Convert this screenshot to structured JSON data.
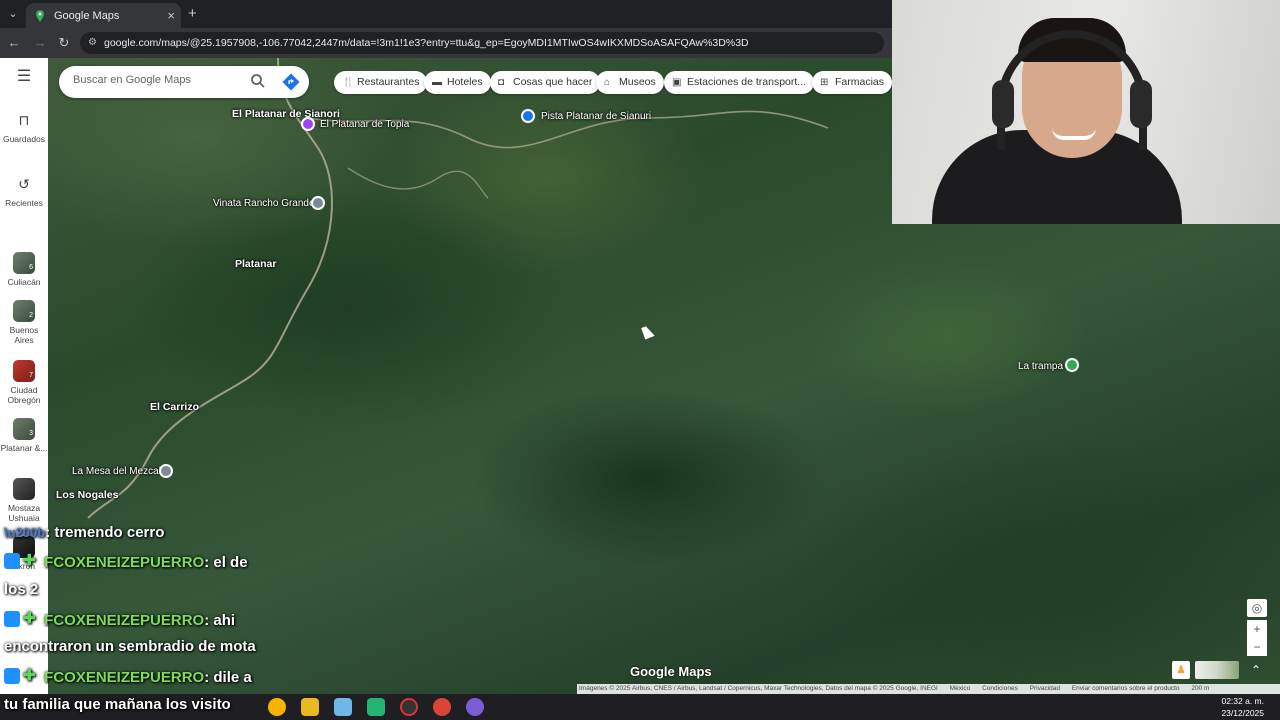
{
  "browser": {
    "tab_title": "Google Maps",
    "url": "google.com/maps/@25.1957908,-106.77042,2447m/data=!3m1!1e3?entry=ttu&g_ep=EgoyMDI1MTIwOS4wIKXMDSoASAFQAw%3D%3D"
  },
  "maps": {
    "search_placeholder": "Buscar en Google Maps",
    "chips": [
      "Restaurantes",
      "Hoteles",
      "Cosas que hacer",
      "Museos",
      "Estaciones de transport...",
      "Farmacias"
    ],
    "sidebar": [
      {
        "label": "Guardados",
        "icon": "bookmark-icon"
      },
      {
        "label": "Recientes",
        "icon": "history-icon"
      },
      {
        "label": "Culiacán",
        "badge": "6"
      },
      {
        "label": "Buenos Aires",
        "badge": "2"
      },
      {
        "label": "Ciudad Obregón",
        "badge": "7"
      },
      {
        "label": "Platanar &...",
        "badge": "3"
      },
      {
        "label": "Mostaza Ushuaia",
        "badge": ""
      },
      {
        "label": "Akron",
        "badge": ""
      }
    ],
    "places": {
      "el_platanar_sianori": "El Platanar de Sianori",
      "el_platanar_topia": "El Platanar de Topia",
      "pista": "Pista Platanar de Sianuri",
      "vinata": "Vinata Rancho Grande",
      "platanar": "Platanar",
      "el_carrizo": "El Carrizo",
      "la_mesa": "La Mesa del Mezcal",
      "los_nogales": "Los Nogales",
      "la_trampa": "La trampa"
    },
    "logo": "Google Maps",
    "attribution": "Imágenes © 2025 Airbus, CNES / Airbus, Landsat / Copernicus, Maxar Technologies, Datos del mapa © 2025 Google, INEGI",
    "footer_links": [
      "México",
      "Condiciones",
      "Privacidad",
      "Enviar comentarios sobre el producto"
    ],
    "scale": "200 m"
  },
  "chat": [
    {
      "user": "",
      "text": ": tremendo cerro"
    },
    {
      "user": "FCOXENEIZEPUERRO",
      "text": ": el de"
    },
    {
      "user": "",
      "text": "los 2"
    },
    {
      "user": "FCOXENEIZEPUERRO",
      "text": ": ahi"
    },
    {
      "user": "",
      "text": "encontraron un sembradio de mota"
    },
    {
      "user": "FCOXENEIZEPUERRO",
      "text": ": dile a"
    },
    {
      "user": "",
      "text": "tu familia que mañana los visito"
    }
  ],
  "taskbar": {
    "time": "02:32 a. m.",
    "date": "23/12/2025"
  },
  "colors": {
    "chat_user": "#7ddc5a",
    "maps_blue": "#1a73e8",
    "pin_purple": "#a142f4"
  }
}
